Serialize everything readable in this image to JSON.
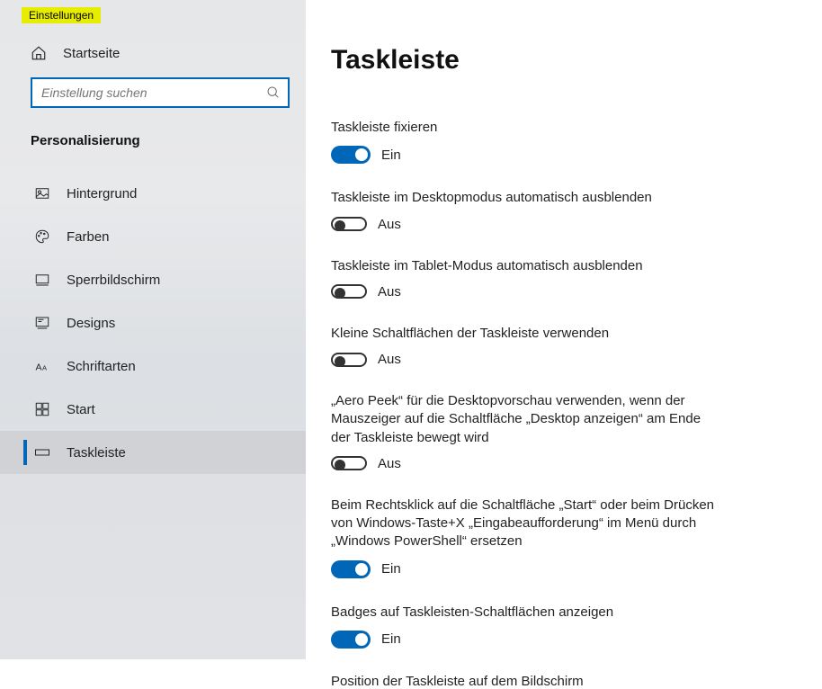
{
  "window": {
    "title": "Einstellungen"
  },
  "home": {
    "label": "Startseite"
  },
  "search": {
    "placeholder": "Einstellung suchen"
  },
  "section": {
    "header": "Personalisierung"
  },
  "nav": [
    {
      "label": "Hintergrund"
    },
    {
      "label": "Farben"
    },
    {
      "label": "Sperrbildschirm"
    },
    {
      "label": "Designs"
    },
    {
      "label": "Schriftarten"
    },
    {
      "label": "Start"
    },
    {
      "label": "Taskleiste"
    }
  ],
  "page": {
    "title": "Taskleiste"
  },
  "toggles": {
    "on_label": "Ein",
    "off_label": "Aus"
  },
  "settings": [
    {
      "label": "Taskleiste fixieren",
      "state": "on"
    },
    {
      "label": "Taskleiste im Desktopmodus automatisch ausblenden",
      "state": "off"
    },
    {
      "label": "Taskleiste im Tablet-Modus automatisch ausblenden",
      "state": "off"
    },
    {
      "label": "Kleine Schaltflächen der Taskleiste verwenden",
      "state": "off"
    },
    {
      "label": "„Aero Peek“ für die Desktopvorschau verwenden, wenn der Mauszeiger auf die Schaltfläche „Desktop anzeigen“ am Ende der Taskleiste bewegt wird",
      "state": "off"
    },
    {
      "label": "Beim Rechtsklick auf die Schaltfläche „Start“ oder beim Drücken von Windows-Taste+X „Eingabeaufforderung“ im Menü durch „Windows PowerShell“ ersetzen",
      "state": "on"
    },
    {
      "label": "Badges auf Taskleisten-Schaltflächen anzeigen",
      "state": "on"
    }
  ],
  "cut_label": "Position der Taskleiste auf dem Bildschirm"
}
